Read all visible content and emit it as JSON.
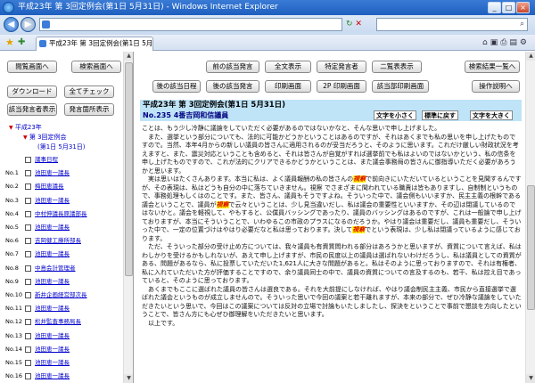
{
  "window": {
    "title": "平成23年 第 3回定例会(第1日 5月31日) - Windows Internet Explorer"
  },
  "browser": {
    "address": "",
    "tab_title": "平成23年 第 3回定例会(第1日 5月31日)",
    "search_placeholder": ""
  },
  "left": {
    "buttons": {
      "menu": "閲覧画面へ",
      "search_screen": "検索画面へ",
      "download": "ダウンロード",
      "check_all": "全てチェック",
      "show_speaker": "該当発言者表示",
      "hide_speaker": "発言箇所表示"
    },
    "tree": {
      "year": "平成23年",
      "session": "第 3回定例会",
      "day": "(第1日 5月31日)"
    },
    "members": [
      {
        "no": "",
        "name": "議事日程"
      },
      {
        "no": "No.1",
        "name": "池田恵一議長"
      },
      {
        "no": "No.2",
        "name": "梅田恵議長"
      },
      {
        "no": "No.3",
        "name": "池田恵一議長"
      },
      {
        "no": "No.4",
        "name": "中村伸議長原議部長"
      },
      {
        "no": "No.5",
        "name": "池田恵一議長"
      },
      {
        "no": "No.6",
        "name": "吉岡健工藤所部長"
      },
      {
        "no": "No.7",
        "name": "池田恵一議長"
      },
      {
        "no": "No.8",
        "name": "中島会計管理者"
      },
      {
        "no": "No.9",
        "name": "池田恵一議長"
      },
      {
        "no": "No.10",
        "name": "新井企画経営部次長"
      },
      {
        "no": "No.11",
        "name": "池田恵一議長"
      },
      {
        "no": "No.12",
        "name": "松井監査事務局長"
      },
      {
        "no": "No.13",
        "name": "池田恵一議長"
      },
      {
        "no": "No.14",
        "name": "池田恵一議長"
      },
      {
        "no": "No.15",
        "name": "池田恵一議長"
      },
      {
        "no": "No.16",
        "name": "池田恵一議長"
      }
    ]
  },
  "right": {
    "buttons": {
      "prev_speaker": "前の該当発言",
      "full_text": "全文表示",
      "specific_speaker": "特定発言者",
      "two_col": "二覧表表示",
      "back_to_list": "検索結果一覧へ",
      "next_speaker": "後の該当日程",
      "next_page": "後の該当発言",
      "print": "印刷画面",
      "print_2p": "2P 印刷画面",
      "print_hit": "該当部印刷画面",
      "help": "操作説明へ"
    },
    "heading": "平成23年 第 3回定例会(第1日 5月31日)",
    "speaker": "No.235 4番吉岡和信議員",
    "size_buttons": {
      "smaller": "文字を小さく",
      "reset": "標準に戻す",
      "larger": "文字を大きく"
    },
    "paragraphs": [
      "ことは、もう少し冷静に議論をしていただく必要があるのではないかなと、そんな思いで申し上げました。",
      "　また、選挙という部分についても、法的に可能かどうかということはあるのですが、それはあくまでも私の思いを申し上げたものですので。当然、本年4月からの新しい議員の皆さんに適用されるのが妥当だろうと、そのように思います。これだけ厳しい財政状況を考えますと、また、震災対応ということも含めると、それは皆さんが自覚がすれば選挙前でも私はよいのではないかという、私の信条を申し上げたものですので、これが法的にクリアできるかどうかということは、また議会事務局の皆さんに御指導いただく必要があろうかと思います。",
      "　実は思いはたくさんあります。本当に私は、よく議員報酬の私の皆さんの 視察 で前向きにいただいているということを見聞するんですが、その表現は、私はどうも自分の中に落ちていきません。視察 でさまざまに聞われている職責は皆もありますし、自制制というもので、事務処理もしくはのことです。また、皆さん、議員もそうですよね。そういった中で、議会側もいいますか、民主主義の根幹である議会ということで、議員が 視察 で云々ということは、少し見当違いだし、私は議会の重要性といいますか、その辺は閉議しているのではないかと。議会を軽視して、やもすると、公僕員バッシングであったり、議員のバッシングはあるのですが、これは一般論で申し上げておりますが、本当にそういうことで、いわゆるこの市政のプラスになるのだろうか。やはり議会は重要だし、議員も重要だし、そういった中で、一定の位置づけはやはり必要だなと私は思っております。決して 視察 でという表現は、少し私は閉議っているように感じております。",
      "　ただ、そういった部分の受け止め方については、我々議員も有資質問われる部分はあろうかと思いますが、資質について言えば、私はわしかりを受けるかもしれないが、あえて申し上げますが、市民の民度以上の議員は選ばれないわけだろうし、私は議員としての資質がある、問題があるなら、私に投票していただいた1,621人に大きな問題があると。私はそのように思っておりますので、それは有権者、私に入れていただいた方が評価することですので、余り議員同士の中で、議員の資質についての言及するのも、若干、私は控え目であっていると、そのように思っております。",
      "　あくまでもここに選ばれた議員の皆さんは選良である。それを大前提にしなければ、やはり議会制民主主義、市民から直接選挙で選ばれた議会というものが成立しませんので。そういった思いで今回の議案と若干離れますが、本来の部分で、ぜひ冷静な議論をしていただきたいという思いで、今回はこの議案については反対の立場で討論もいたしましたし、探決をということで事前で懇談を方向したということで、皆さん方にも心ぜひ御理解をいただきたいと思います。",
      "　以上です。"
    ]
  }
}
